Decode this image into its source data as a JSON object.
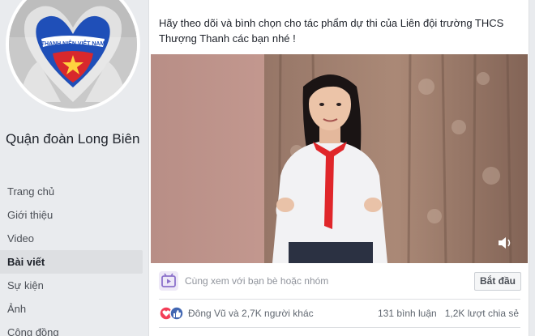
{
  "page": {
    "name": "Quận đoàn Long Biên",
    "badge_text": "THANH NIÊN VIỆT NAM"
  },
  "nav": {
    "items": [
      {
        "label": "Trang chủ",
        "active": false
      },
      {
        "label": "Giới thiệu",
        "active": false
      },
      {
        "label": "Video",
        "active": false
      },
      {
        "label": "Bài viết",
        "active": true
      },
      {
        "label": "Sự kiện",
        "active": false
      },
      {
        "label": "Ảnh",
        "active": false
      },
      {
        "label": "Cộng đồng",
        "active": false
      }
    ]
  },
  "post": {
    "text": "Hãy theo dõi và bình chọn cho tác phẩm dự thi của Liên đội trường THCS Thượng Thanh các bạn nhé !",
    "watch_party_text": "Cùng xem với bạn bè hoặc nhóm",
    "start_button": "Bắt đầu",
    "reactions_text": "Đông Vũ và 2,7K người khác",
    "comments": "131 bình luận",
    "shares": "1,2K lượt chia sẻ",
    "icons": [
      "heart-reaction-icon",
      "like-reaction-icon",
      "watch-party-icon",
      "mute-icon"
    ]
  },
  "colors": {
    "accent": "#4267b2",
    "heart": "#f33e58",
    "scarf": "#e0262a",
    "background": "#e9ebee"
  }
}
